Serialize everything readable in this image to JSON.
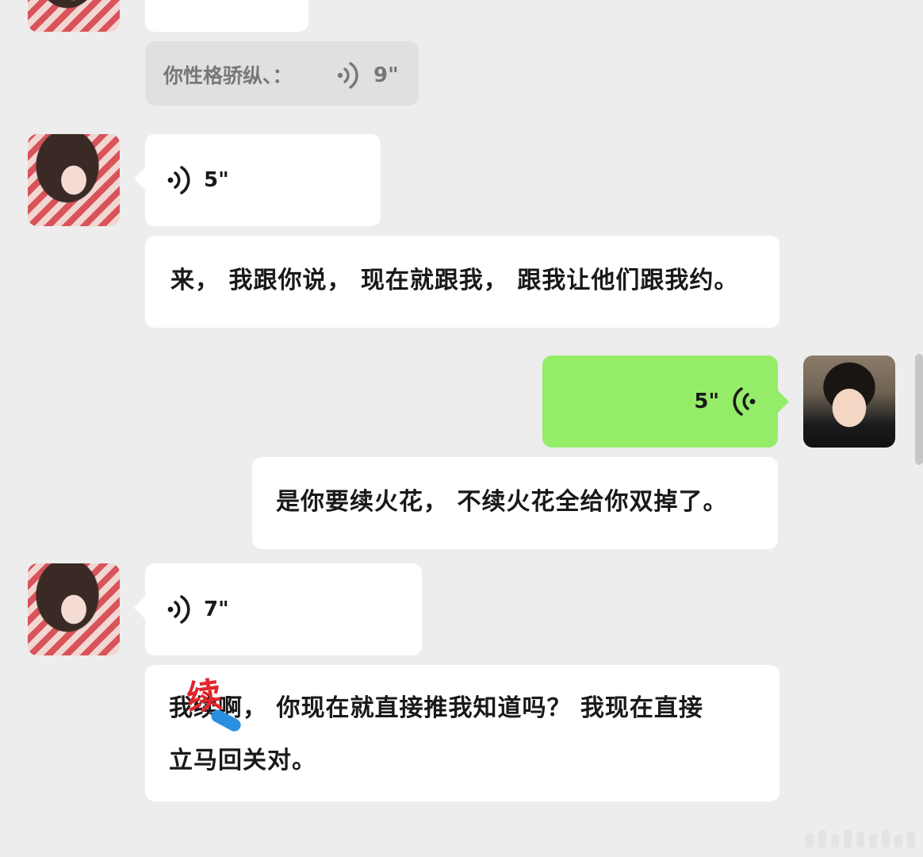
{
  "messages": [
    {
      "id": "m1",
      "side": "left",
      "type": "partial-bubble"
    },
    {
      "id": "m1q",
      "side": "left",
      "type": "quote",
      "text": "你性格骄纵、：",
      "duration": "9\""
    },
    {
      "id": "m2",
      "side": "left",
      "type": "voice",
      "duration": "5\""
    },
    {
      "id": "m2t",
      "side": "left",
      "type": "transcript",
      "text": "来， 我跟你说， 现在就跟我， 跟我让他们跟我约。"
    },
    {
      "id": "m3",
      "side": "right",
      "type": "voice",
      "duration": "5\""
    },
    {
      "id": "m3t",
      "side": "right",
      "type": "transcript",
      "text": "是你要续火花， 不续火花全给你双掉了。"
    },
    {
      "id": "m4",
      "side": "left",
      "type": "voice",
      "duration": "7\""
    },
    {
      "id": "m4t",
      "side": "left",
      "type": "transcript",
      "line1": "我续啊， 你现在就直接推我知道吗？ 我现在直接",
      "line2": "立马回关对。"
    }
  ],
  "sticker": {
    "text": "续"
  },
  "colors": {
    "background": "#ededed",
    "incoming": "#ffffff",
    "outgoing": "#95ec69",
    "sticker": "#e0262b"
  }
}
